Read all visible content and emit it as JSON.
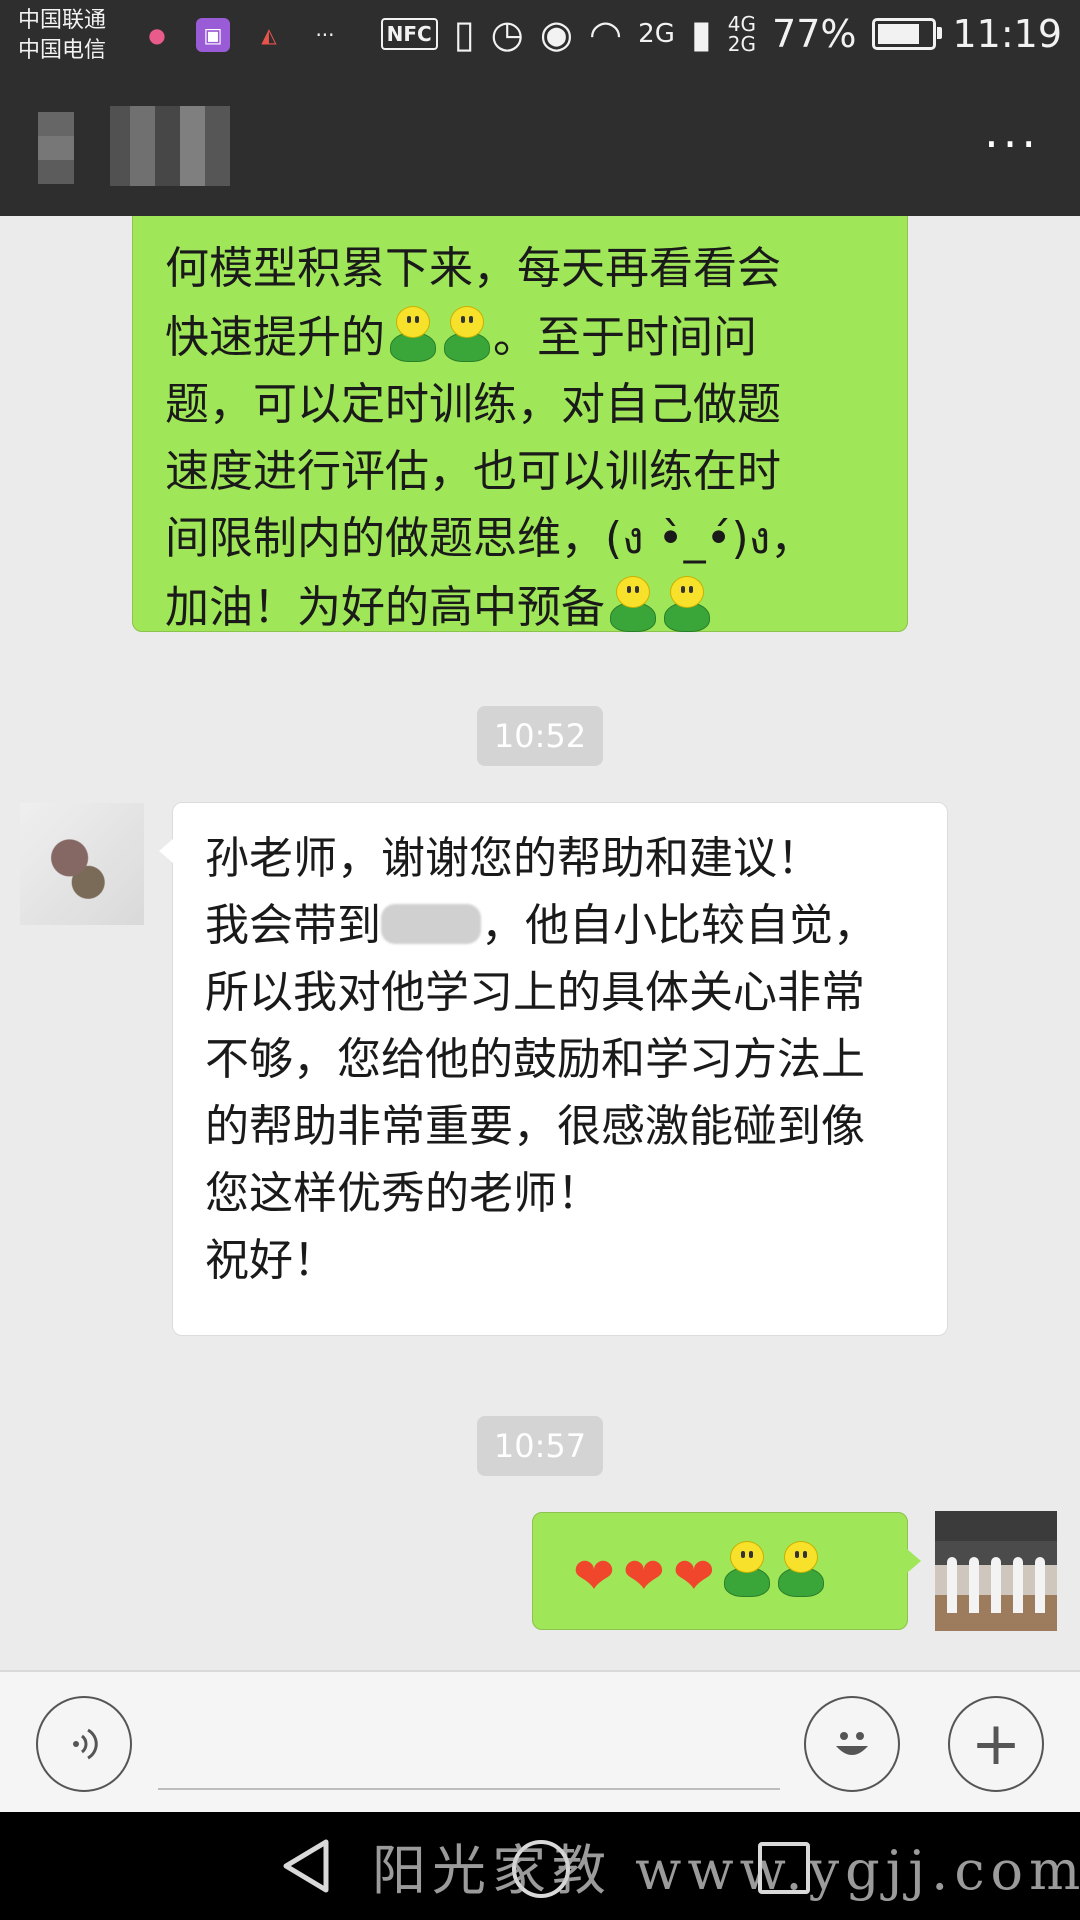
{
  "status_bar": {
    "carrier_1": "中国联通",
    "carrier_2": "中国电信",
    "more_icons": "···",
    "nfc": "NFC",
    "net_2g": "2G",
    "net_4g": "4G",
    "net_2g_b": "2G",
    "battery_percent": "77%",
    "battery_level": 0.77,
    "time": "11:19"
  },
  "title_bar": {
    "more_label": "···"
  },
  "messages": {
    "m1": {
      "line1": "何模型积累下来，每天再看看会",
      "line2a": "快速提升的",
      "line2b": "。至于时间问",
      "line3": "题，可以定时训练，对自己做题",
      "line4": "速度进行评估，也可以训练在时",
      "line5": "间限制内的做题思维，(ง •̀_•́)ง，",
      "line6a": "加油！为好的高中预备"
    },
    "time1": "10:52",
    "m2": {
      "line1": "孙老师，谢谢您的帮助和建议！",
      "line2a": "我会带到",
      "line2b": "，他自小比较自觉，",
      "line3": "所以我对他学习上的具体关心非常",
      "line4": "不够，您给他的鼓励和学习方法上",
      "line5": "的帮助非常重要，很感激能碰到像",
      "line6": "您这样优秀的老师！",
      "line7": "祝好！"
    },
    "time2": "10:57",
    "m3": {
      "heart": "❤"
    }
  },
  "input_bar": {
    "voice_icon": "voice-icon",
    "emoji_icon": "emoji-icon",
    "plus_label": "+"
  },
  "nav_bar": {
    "watermark": "阳光家教 www.ygjj.com"
  },
  "colors": {
    "outgoing_bubble": "#9fe658",
    "incoming_bubble": "#ffffff",
    "bar_dark": "#2e2e2e",
    "heart": "#f0462b"
  }
}
